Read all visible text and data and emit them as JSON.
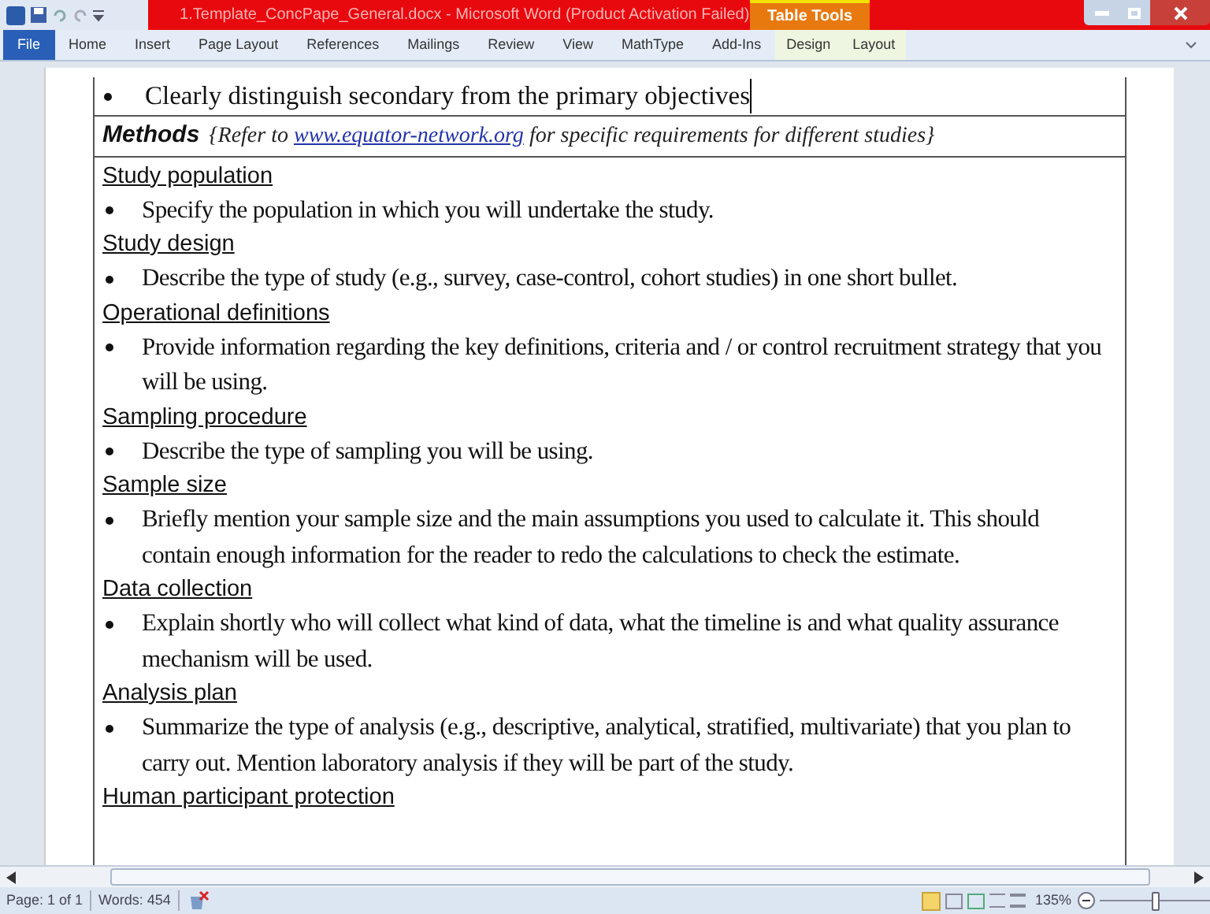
{
  "window": {
    "title": "1.Template_ConcPape_General.docx - Microsoft Word (Product Activation Failed)",
    "context_tab": "Table Tools"
  },
  "ribbon_tabs": [
    {
      "label": "File",
      "selected": true,
      "contextual": false
    },
    {
      "label": "Home",
      "selected": false,
      "contextual": false
    },
    {
      "label": "Insert",
      "selected": false,
      "contextual": false
    },
    {
      "label": "Page Layout",
      "selected": false,
      "contextual": false
    },
    {
      "label": "References",
      "selected": false,
      "contextual": false
    },
    {
      "label": "Mailings",
      "selected": false,
      "contextual": false
    },
    {
      "label": "Review",
      "selected": false,
      "contextual": false
    },
    {
      "label": "View",
      "selected": false,
      "contextual": false
    },
    {
      "label": "MathType",
      "selected": false,
      "contextual": false
    },
    {
      "label": "Add-Ins",
      "selected": false,
      "contextual": false
    },
    {
      "label": "Design",
      "selected": false,
      "contextual": true
    },
    {
      "label": "Layout",
      "selected": false,
      "contextual": true
    }
  ],
  "document": {
    "top_bullet": "Clearly distinguish secondary from the primary objectives",
    "methods": {
      "title": "Methods",
      "note_before": "{Refer to",
      "link": "www.equator-network.org",
      "note_after": "for specific requirements for different studies}"
    },
    "sections": [
      {
        "heading": "Study population",
        "bullets": [
          "Specify the population in which you will undertake the study."
        ]
      },
      {
        "heading": "Study design",
        "bullets": [
          "Describe the type of study (e.g., survey, case-control, cohort studies) in one short bullet."
        ]
      },
      {
        "heading": "Operational definitions",
        "bullets": [
          "Provide information regarding the key definitions, criteria and / or control recruitment strategy that you will be using."
        ]
      },
      {
        "heading": "Sampling procedure",
        "bullets": [
          "Describe the type of sampling you will be using."
        ]
      },
      {
        "heading": "Sample size",
        "bullets": [
          "Briefly mention your sample size and the main assumptions you used to calculate it. This should contain enough information for the reader to redo the calculations to check the estimate."
        ]
      },
      {
        "heading": "Data collection",
        "bullets": [
          "Explain shortly who will collect what kind of data, what the timeline is and what quality assurance mechanism will be used."
        ]
      },
      {
        "heading": "Analysis plan",
        "bullets": [
          "Summarize the type of analysis (e.g., descriptive, analytical, stratified, multivariate) that you plan to carry out. Mention laboratory analysis if they will be part of the study."
        ]
      },
      {
        "heading": "Human participant protection"
      }
    ]
  },
  "status_bar": {
    "page": "Page: 1 of 1",
    "words": "Words: 454",
    "zoom": "135%",
    "zoom_slider": {
      "level": 0.5
    }
  }
}
